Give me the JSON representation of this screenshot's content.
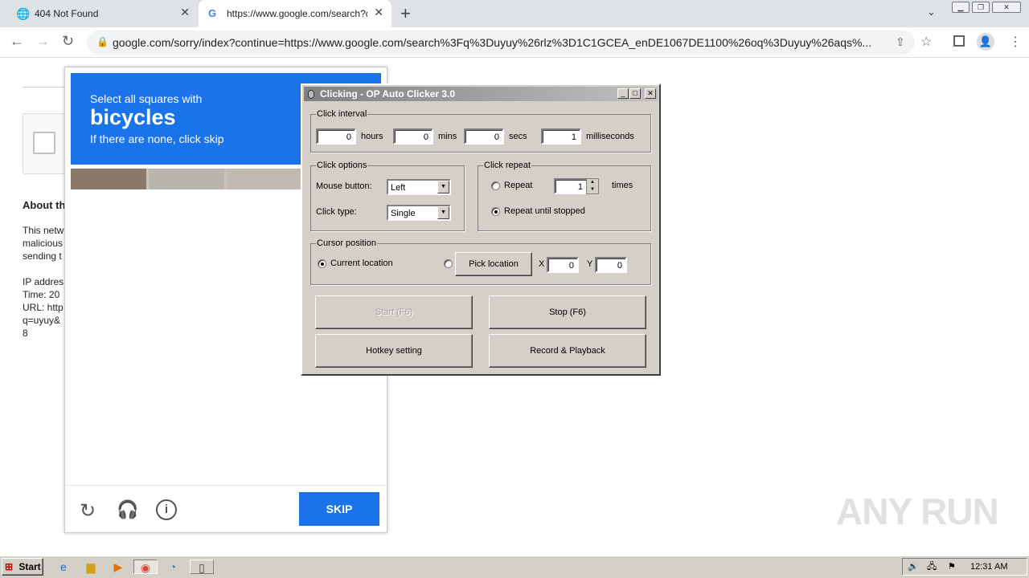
{
  "browser": {
    "tabs": [
      {
        "title": "404 Not Found"
      },
      {
        "title": "https://www.google.com/search?q="
      }
    ],
    "url": "google.com/sorry/index?continue=https://www.google.com/search%3Fq%3Duyuy%26rlz%3D1C1GCEA_enDE1067DE1100%26oq%3Duyuy%26aqs%..."
  },
  "page": {
    "heading": "About th",
    "lines": [
      "This netw",
      "malicious",
      "sending t"
    ],
    "info": [
      "IP addres",
      "Time: 20",
      "URL: http",
      "q=uyuy&",
      "8"
    ]
  },
  "captcha": {
    "instruction": "Select all squares with",
    "target": "bicycles",
    "hint": "If there are none, click skip",
    "skip_label": "SKIP"
  },
  "autoclicker": {
    "title": "Clicking - OP Auto Clicker 3.0",
    "interval": {
      "label": "Click interval",
      "hours": "0",
      "hours_label": "hours",
      "mins": "0",
      "mins_label": "mins",
      "secs": "0",
      "secs_label": "secs",
      "ms": "1",
      "ms_label": "milliseconds"
    },
    "options": {
      "label": "Click options",
      "mouse_label": "Mouse button:",
      "mouse_value": "Left",
      "type_label": "Click type:",
      "type_value": "Single"
    },
    "repeat": {
      "label": "Click repeat",
      "repeat_label": "Repeat",
      "repeat_value": "1",
      "times_label": "times",
      "until_label": "Repeat until stopped"
    },
    "cursor": {
      "label": "Cursor position",
      "current_label": "Current location",
      "pick_label": "Pick location",
      "x_label": "X",
      "x_value": "0",
      "y_label": "Y",
      "y_value": "0"
    },
    "buttons": {
      "start": "Start (F6)",
      "stop": "Stop (F6)",
      "hotkey": "Hotkey setting",
      "record": "Record & Playback"
    }
  },
  "taskbar": {
    "start_label": "Start",
    "clock": "12:31 AM"
  },
  "watermark": "ANY RUN"
}
